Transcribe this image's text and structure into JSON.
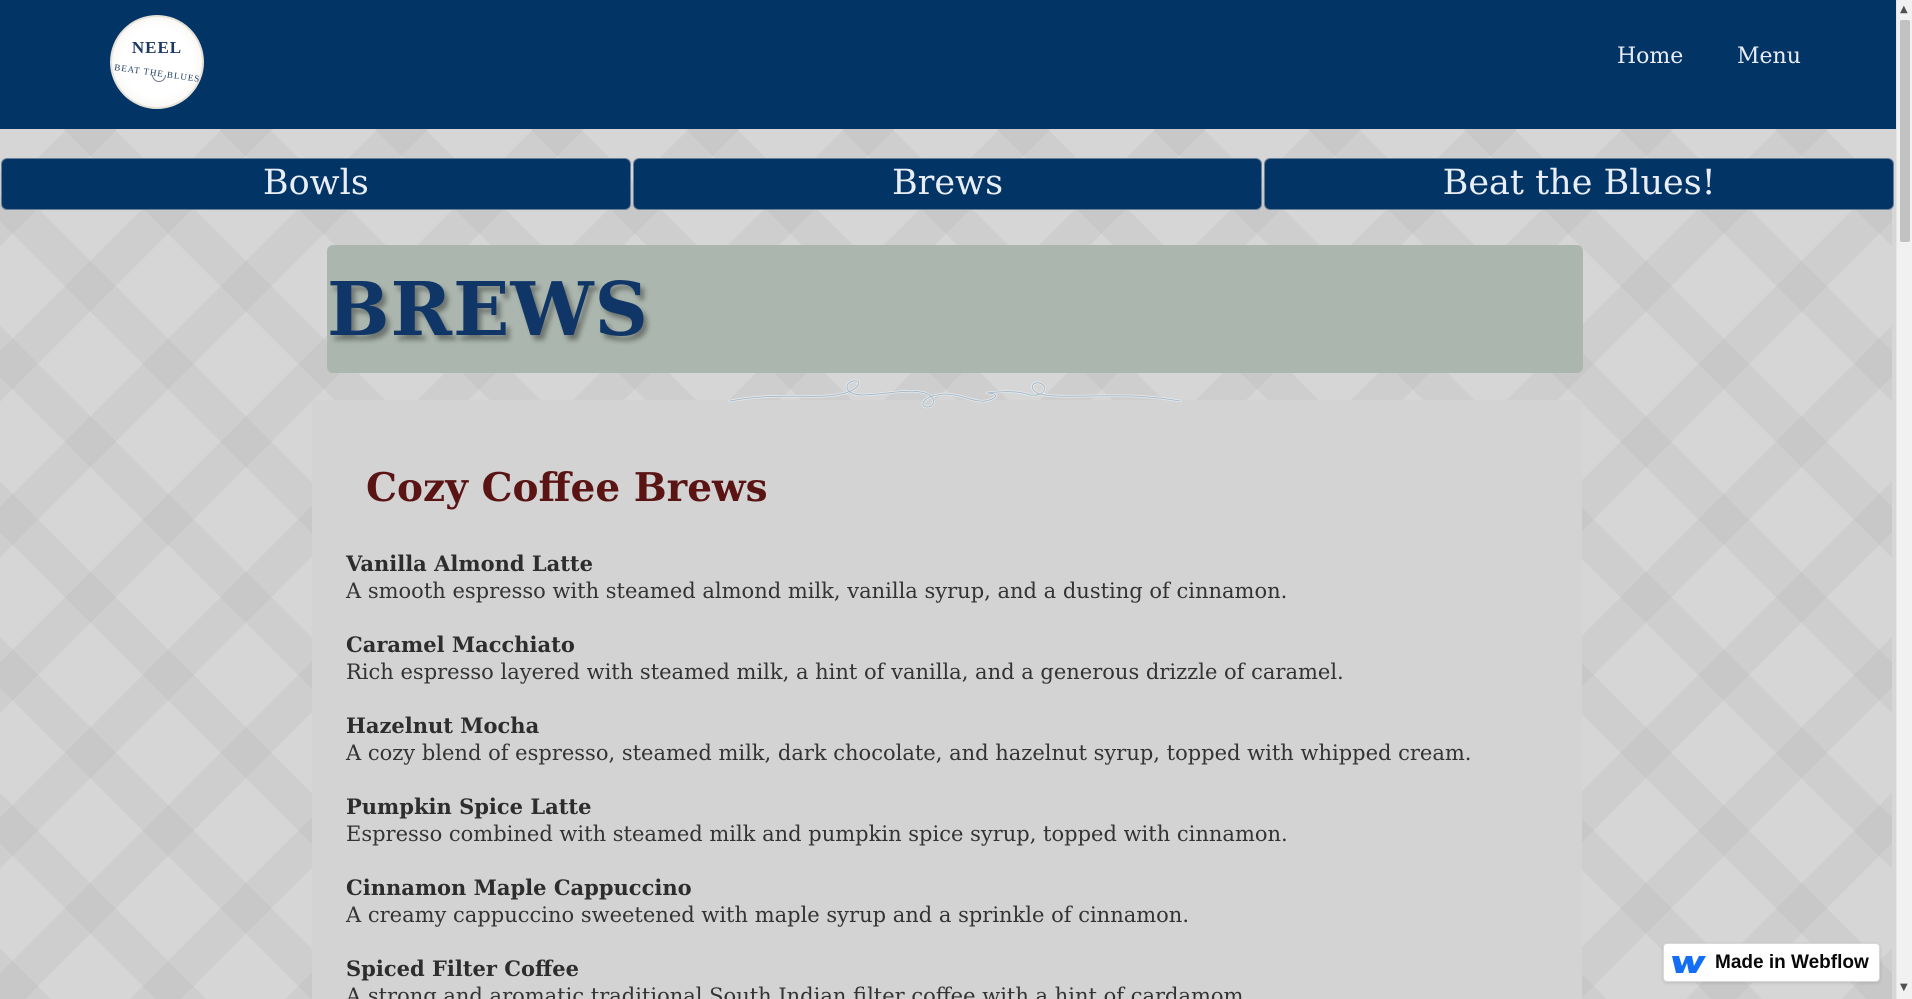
{
  "header": {
    "logo": {
      "top_text": "NEEL",
      "bottom_text": "BEAT THE BLUES"
    },
    "nav": [
      {
        "label": "Home"
      },
      {
        "label": "Menu"
      }
    ]
  },
  "tabs": [
    {
      "label": "Bowls"
    },
    {
      "label": "Brews"
    },
    {
      "label": "Beat the Blues!"
    }
  ],
  "page": {
    "title": "BREWS",
    "section_title": "Cozy Coffee Brews",
    "items": [
      {
        "name": "Vanilla Almond Latte",
        "description": "A smooth espresso with steamed almond milk, vanilla syrup, and a dusting of cinnamon."
      },
      {
        "name": "Caramel Macchiato",
        "description": "Rich espresso layered with steamed milk, a hint of vanilla, and a generous drizzle of caramel."
      },
      {
        "name": "Hazelnut Mocha",
        "description": "A cozy blend of espresso, steamed milk, dark chocolate, and hazelnut syrup, topped with whipped cream."
      },
      {
        "name": "Pumpkin Spice Latte",
        "description": "Espresso combined with steamed milk and pumpkin spice syrup, topped with cinnamon."
      },
      {
        "name": "Cinnamon Maple Cappuccino",
        "description": "A creamy cappuccino sweetened with maple syrup and a sprinkle of cinnamon."
      },
      {
        "name": "Spiced Filter Coffee",
        "description": "A strong and aromatic traditional South Indian filter coffee with a hint of cardamom."
      }
    ]
  },
  "badge": {
    "label": "Made in Webflow"
  },
  "colors": {
    "header_bg": "#033466",
    "title_box": "#abb6ae",
    "section_title": "#5a1414"
  }
}
